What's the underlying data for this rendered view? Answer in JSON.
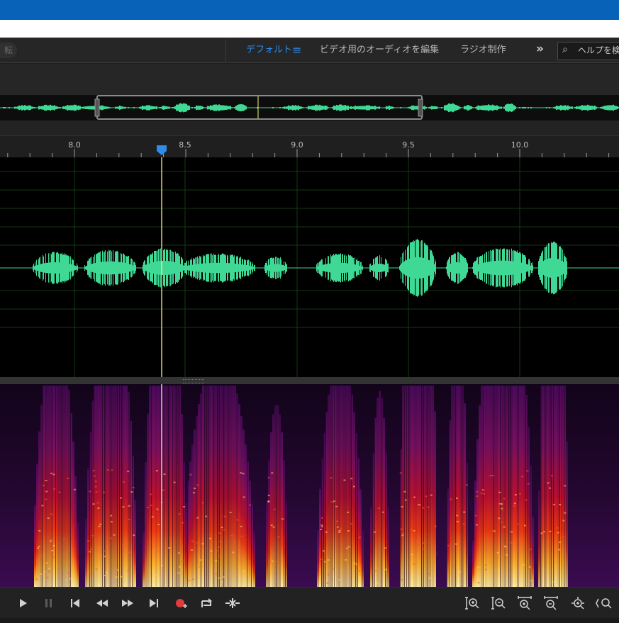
{
  "workspace": {
    "left_label": "転",
    "tabs": [
      {
        "label": "デフォルト",
        "active": true
      },
      {
        "label": "ビデオ用のオーディオを編集",
        "active": false
      },
      {
        "label": "ラジオ制作",
        "active": false
      }
    ],
    "more_icon": "double-chevron-right",
    "help_placeholder": "ヘルプを検"
  },
  "ruler": {
    "labels": [
      "8.0",
      "8.5",
      "9.0",
      "9.5",
      "10.0"
    ]
  },
  "colors": {
    "accent": "#2d8ceb",
    "waveform": "#3fd894",
    "playhead": "#fff27a",
    "title_bar": "#0862b8",
    "record": "#e23b3b"
  },
  "transport": {
    "buttons": [
      "play",
      "pause",
      "go-to-start",
      "rewind",
      "fast-forward",
      "go-to-end",
      "record",
      "loop",
      "skip-selection"
    ],
    "zoom_buttons": [
      "zoom-in-amplitude",
      "zoom-out-amplitude",
      "zoom-in-time",
      "zoom-out-time",
      "zoom-in-at-playhead",
      "zoom-out-full"
    ]
  }
}
